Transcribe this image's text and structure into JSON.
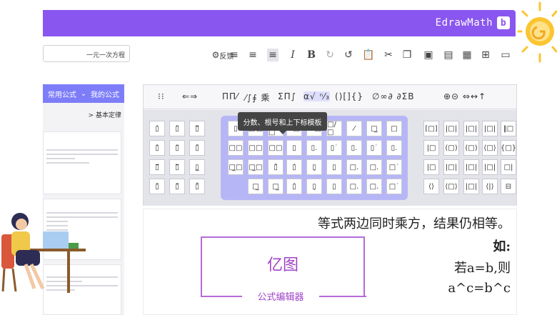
{
  "app": {
    "title": "EdrawMath",
    "logo_letter": "b"
  },
  "toolbar": {
    "search_text": "一元一次方程",
    "feedback_label": "反馈",
    "icons": [
      "settings-icon",
      "align-left-icon",
      "align-center-icon",
      "align-right-icon",
      "italic-icon",
      "bold-icon",
      "undo-icon",
      "redo-icon",
      "paste-icon",
      "cut-icon",
      "copy-icon",
      "save-icon",
      "print-icon",
      "export-icon",
      "add-icon",
      "folder-icon"
    ]
  },
  "left_panel": {
    "tab_common": "常用公式",
    "tab_mine": "我的公式",
    "subheader": "> 基本定律"
  },
  "palette": {
    "categories": [
      "⊕⊝ ⇔↔↑",
      "∅∞∂ ∂ΣΒ",
      "()[]{}",
      "α√ ⁿ⁄₃",
      "ΣΠ∫",
      "⁄∫∮ 乘",
      "ΠΠ⁄",
      "⇐⇒",
      "∈ ⌶"
    ],
    "selected_category": "α√ ⁿ⁄₃",
    "tooltip": "分数、根号和上下标模板"
  },
  "document": {
    "line1": "等式两边同时乘方，结果仍相等。",
    "line2": "如:",
    "line3": "若a=b,则",
    "line4": "a^c=b^c",
    "frame_title": "亿图",
    "frame_subtitle": "公式编辑器"
  }
}
